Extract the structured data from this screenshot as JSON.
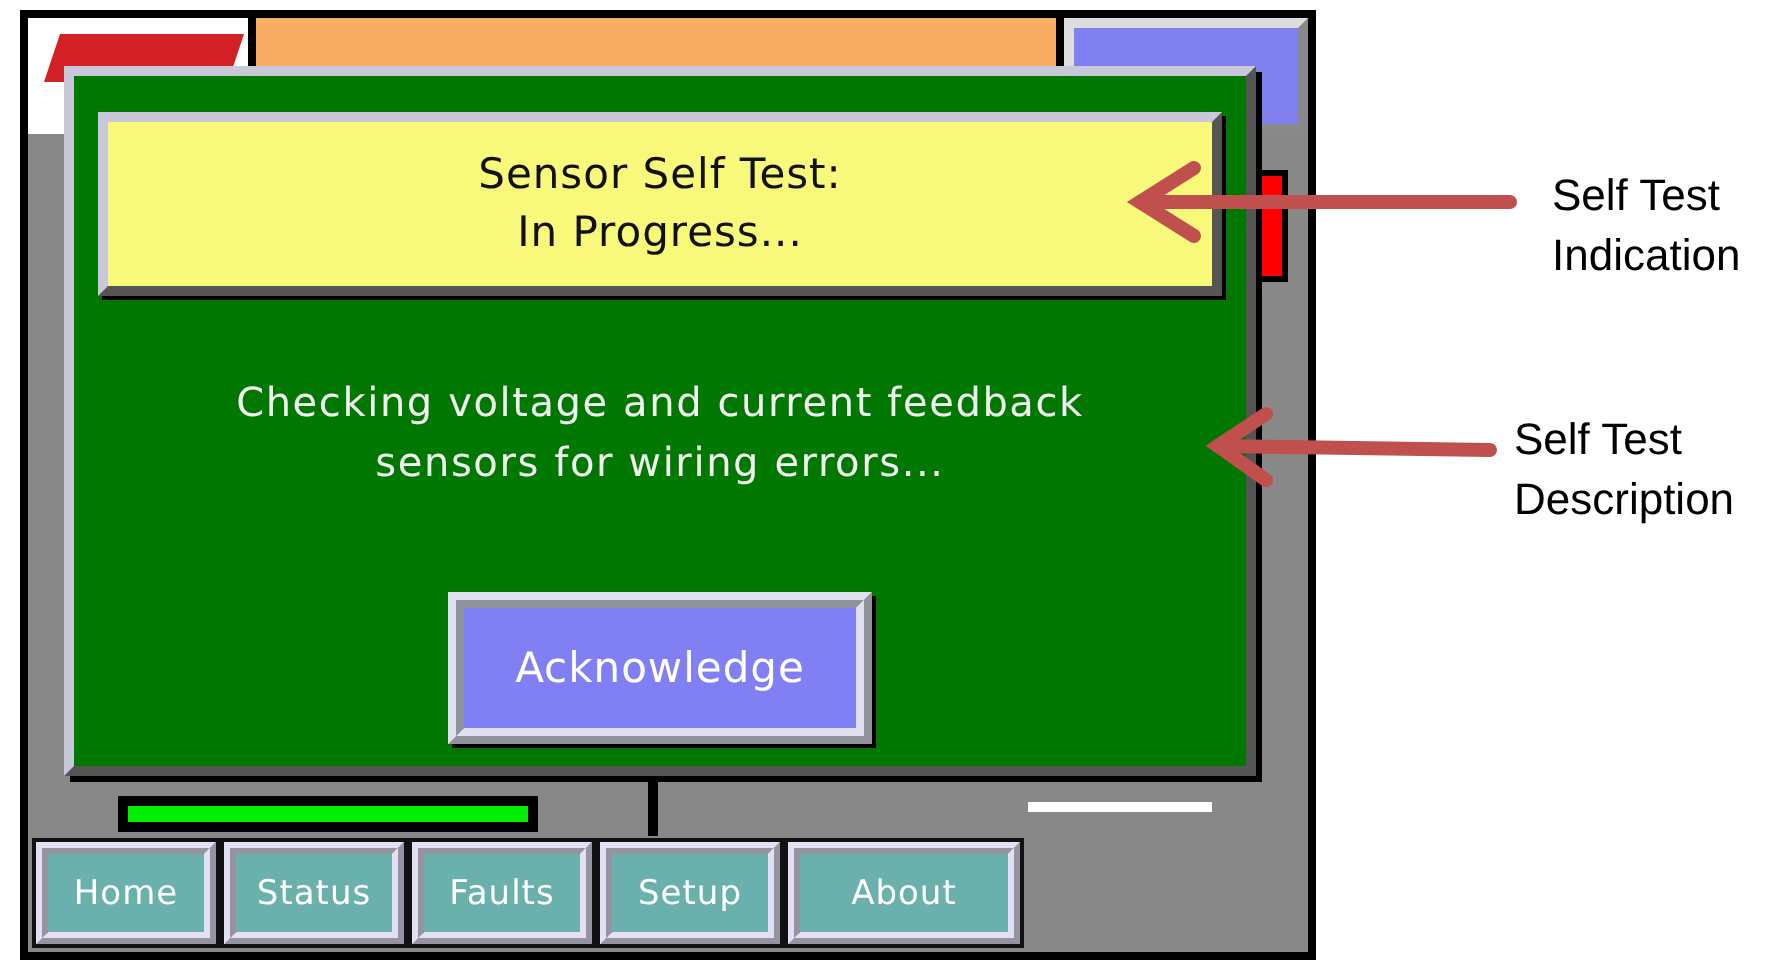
{
  "hmi": {
    "nav_buttons": [
      {
        "label": "Home"
      },
      {
        "label": "Status"
      },
      {
        "label": "Faults"
      },
      {
        "label": "Setup"
      },
      {
        "label": "About"
      }
    ]
  },
  "dialog": {
    "title": "Sensor Self Test:\nIn Progress...",
    "description": "Checking voltage and current feedback\nsensors for wiring errors...",
    "button": "Acknowledge"
  },
  "annotations": [
    {
      "label": "Self Test\nIndication"
    },
    {
      "label": "Self Test\nDescription"
    }
  ]
}
